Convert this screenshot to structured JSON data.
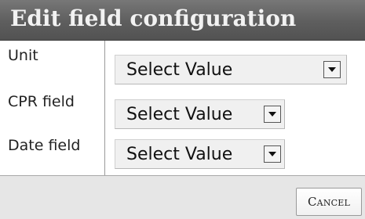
{
  "dialog": {
    "title": "Edit field configuration"
  },
  "fields": [
    {
      "label": "Unit",
      "value": "Select Value"
    },
    {
      "label": "CPR field",
      "value": "Select Value"
    },
    {
      "label": "Date field",
      "value": "Select Value"
    }
  ],
  "footer": {
    "cancel_label": "Cancel"
  },
  "icons": {
    "dropdown": "chevron-down-icon"
  }
}
